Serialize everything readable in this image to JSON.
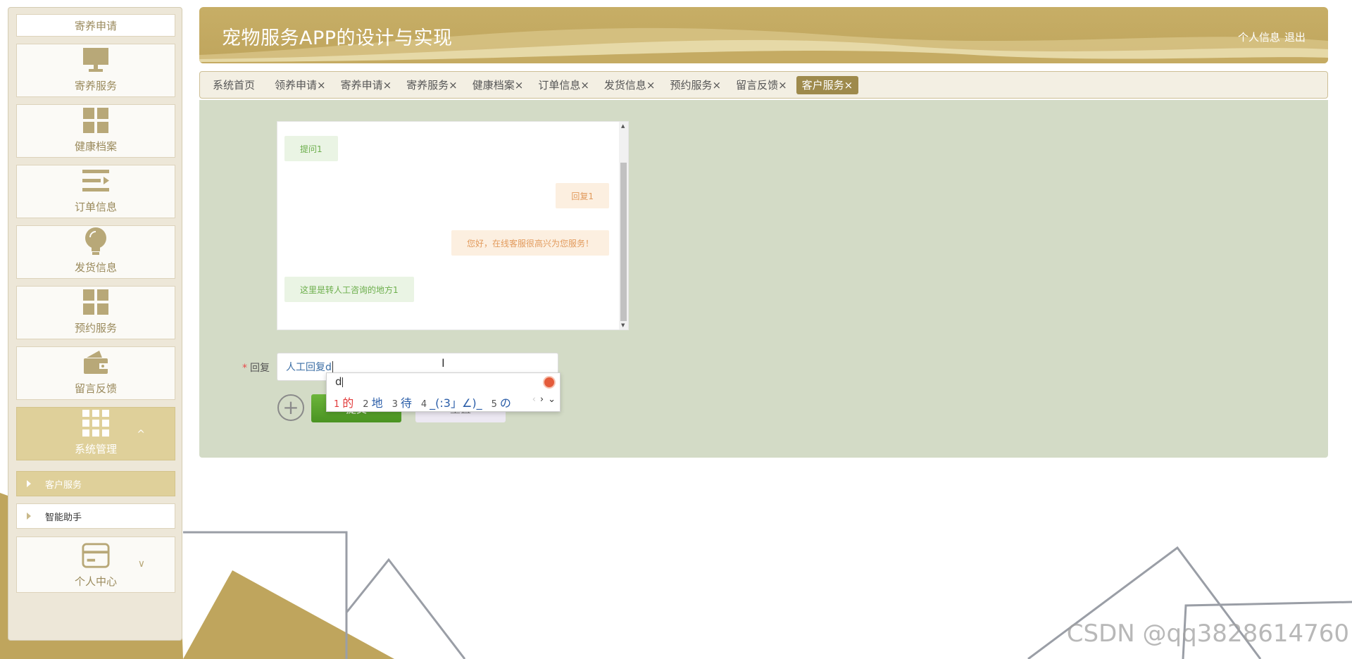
{
  "app": {
    "title": "宠物服务APP的设计与实现",
    "header_links": {
      "profile": "个人信息",
      "logout": "退出"
    }
  },
  "sidebar": {
    "top_item": "寄养申请",
    "items": [
      {
        "label": "寄养服务",
        "icon": "monitor-icon"
      },
      {
        "label": "健康档案",
        "icon": "grid-icon"
      },
      {
        "label": "订单信息",
        "icon": "list-icon"
      },
      {
        "label": "发货信息",
        "icon": "bulb-icon"
      },
      {
        "label": "预约服务",
        "icon": "grid-icon"
      },
      {
        "label": "留言反馈",
        "icon": "wallet-icon"
      },
      {
        "label": "系统管理",
        "icon": "apps-icon",
        "chevron": "^"
      }
    ],
    "sub_items": [
      {
        "label": "客户服务",
        "active": true
      },
      {
        "label": "智能助手",
        "active": false
      }
    ],
    "bottom_item": {
      "label": "个人中心",
      "icon": "card-icon",
      "chevron": "∨"
    }
  },
  "tabs": [
    {
      "label": "系统首页"
    },
    {
      "label": "领养申请×"
    },
    {
      "label": "寄养申请×"
    },
    {
      "label": "寄养服务×"
    },
    {
      "label": "健康档案×"
    },
    {
      "label": "订单信息×"
    },
    {
      "label": "发货信息×"
    },
    {
      "label": "预约服务×"
    },
    {
      "label": "留言反馈×"
    },
    {
      "label": "客户服务×",
      "active": true
    }
  ],
  "chat": {
    "messages": [
      {
        "side": "left",
        "text": "提问1"
      },
      {
        "side": "right",
        "text": "回复1"
      },
      {
        "side": "right",
        "text": "您好，在线客服很高兴为您服务！"
      },
      {
        "side": "left",
        "text": "这里是转人工咨询的地方1"
      }
    ]
  },
  "form": {
    "required_mark": "*",
    "reply_label": "回复",
    "reply_value": "人工回复d",
    "submit_label": "提交",
    "reset_label": "重置",
    "add_icon": "plus-circle-icon"
  },
  "ime": {
    "composition": "d",
    "candidates": [
      {
        "num": "1",
        "text": "的"
      },
      {
        "num": "2",
        "text": "地"
      },
      {
        "num": "3",
        "text": "待"
      },
      {
        "num": "4",
        "text": "_(:3」∠)_"
      },
      {
        "num": "5",
        "text": "の"
      }
    ],
    "prev": "‹",
    "next": "›",
    "more": "⌄"
  },
  "watermark": "CSDN @qq3828614760",
  "colors": {
    "gold": "#bfa55d",
    "tab_active": "#9e8a4c",
    "content_bg": "#d3dbc6",
    "submit_green": "#5aa32c",
    "question_text": "#6cae4b",
    "answer_text": "#e29b5d"
  }
}
